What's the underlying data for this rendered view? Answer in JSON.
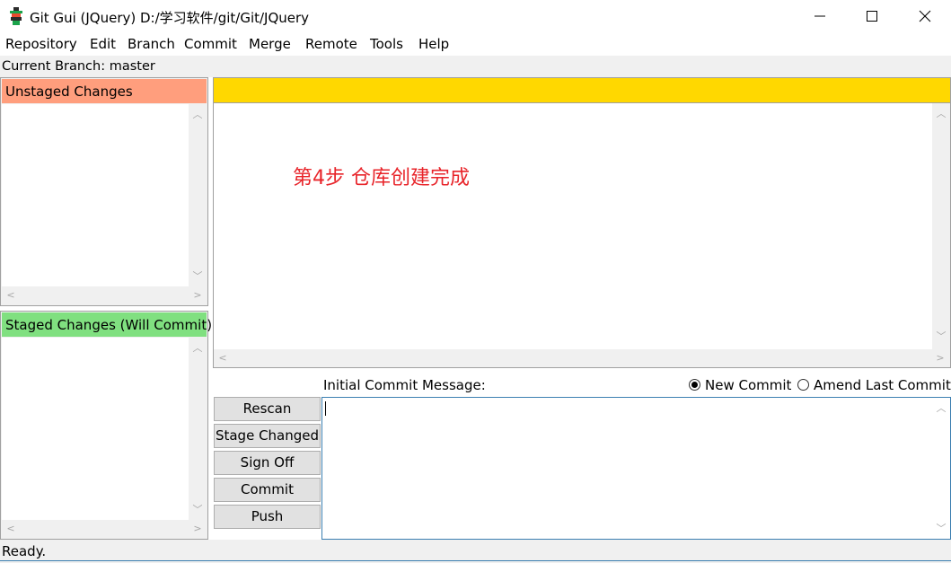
{
  "window": {
    "title": "Git Gui (JQuery) D:/学习软件/git/Git/JQuery",
    "icon": "git-gui-icon",
    "controls": [
      "minimize-icon",
      "maximize-icon",
      "close-icon"
    ]
  },
  "menu": {
    "items": [
      {
        "label": "Repository"
      },
      {
        "label": "Edit"
      },
      {
        "label": "Branch"
      },
      {
        "label": "Commit"
      },
      {
        "label": "Merge"
      },
      {
        "label": "Remote"
      },
      {
        "label": "Tools"
      },
      {
        "label": "Help"
      }
    ]
  },
  "branch": {
    "text": "Current Branch: master"
  },
  "unstaged": {
    "header": "Unstaged Changes",
    "color": "#ff9e7d"
  },
  "staged": {
    "header": "Staged Changes (Will Commit)",
    "color": "#80e080"
  },
  "diff": {
    "header_color": "#ffd800",
    "annotation": "第4步 仓库创建完成",
    "annotation_color": "#e8242a"
  },
  "commit": {
    "message_label": "Initial Commit Message:",
    "message_value": "",
    "options": [
      {
        "label": "New Commit",
        "checked": true
      },
      {
        "label": "Amend Last Commit",
        "checked": false
      }
    ],
    "buttons": {
      "rescan": "Rescan",
      "stage_changed": "Stage Changed",
      "sign_off": "Sign Off",
      "commit": "Commit",
      "push": "Push"
    }
  },
  "status": {
    "text": "Ready."
  }
}
